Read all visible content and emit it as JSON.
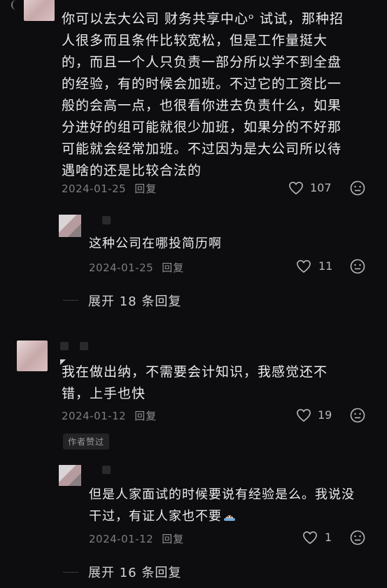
{
  "comments": [
    {
      "text": "你可以去大公司 财务共享中心ᵒ 试试，那种招人很多而且条件比较宽松，但是工作量挺大的，而且一个人只负责一部分所以学不到全盘的经验，有的时候会加班。不过它的工资比一般的会高一点，也很看你进去负责什么，如果分进好的组可能就很少加班，如果分的不好那可能就会经常加班。不过因为是大公司所以待遇啥的还是比较合法的",
      "date": "2024-01-25",
      "reply_label": "回复",
      "likes": "107"
    },
    {
      "text": "这种公司在哪投简历啊",
      "date": "2024-01-25",
      "reply_label": "回复",
      "likes": "11"
    },
    {
      "text": "我在做出纳，不需要会计知识，我感觉还不错，上手也快",
      "date": "2024-01-12",
      "reply_label": "回复",
      "likes": "19",
      "badge": "作者赞过"
    },
    {
      "text": "但是人家面试的时候要说有经验是么。我说没干过，有证人家也不要",
      "date": "2024-01-12",
      "reply_label": "回复",
      "likes": "1"
    }
  ],
  "expand_replies": [
    "展开 18 条回复",
    "展开 16 条回复"
  ],
  "icons": {
    "like": "heart-icon",
    "dislike": "neutral-face-icon",
    "emoji": "sweat-face-emoji"
  },
  "colors": {
    "background": "#0d0d0f",
    "text": "#ececee",
    "meta": "#7d7d82"
  }
}
